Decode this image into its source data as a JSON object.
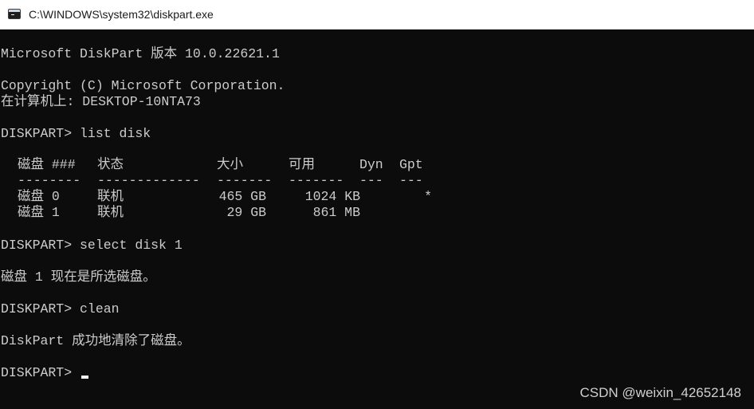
{
  "window": {
    "title": "C:\\WINDOWS\\system32\\diskpart.exe",
    "icon": "console-window-icon"
  },
  "console": {
    "version_line": "Microsoft DiskPart 版本 10.0.22621.1",
    "copyright_line": "Copyright (C) Microsoft Corporation.",
    "computer_line": "在计算机上: DESKTOP-10NTA73",
    "cmd_list": "DISKPART> list disk",
    "table": {
      "headers": [
        "磁盘 ###",
        "状态",
        "大小",
        "可用",
        "Dyn",
        "Gpt"
      ],
      "separators": [
        "--------",
        "-------------",
        "-------",
        "-------",
        "---",
        "---"
      ],
      "rows": [
        {
          "disk": "磁盘 0",
          "status": "联机",
          "size": "465 GB",
          "free": "1024 KB",
          "dyn": "",
          "gpt": "*"
        },
        {
          "disk": "磁盘 1",
          "status": "联机",
          "size": "29 GB",
          "free": "861 MB",
          "dyn": "",
          "gpt": ""
        }
      ]
    },
    "cmd_select": "DISKPART> select disk 1",
    "select_result": "磁盘 1 现在是所选磁盘。",
    "cmd_clean": "DISKPART> clean",
    "clean_result": "DiskPart 成功地清除了磁盘。",
    "prompt": "DISKPART> "
  },
  "watermark": "CSDN @weixin_42652148",
  "colors": {
    "console_bg": "#0c0c0c",
    "console_text": "#cccccc",
    "titlebar_bg": "#ffffff"
  }
}
